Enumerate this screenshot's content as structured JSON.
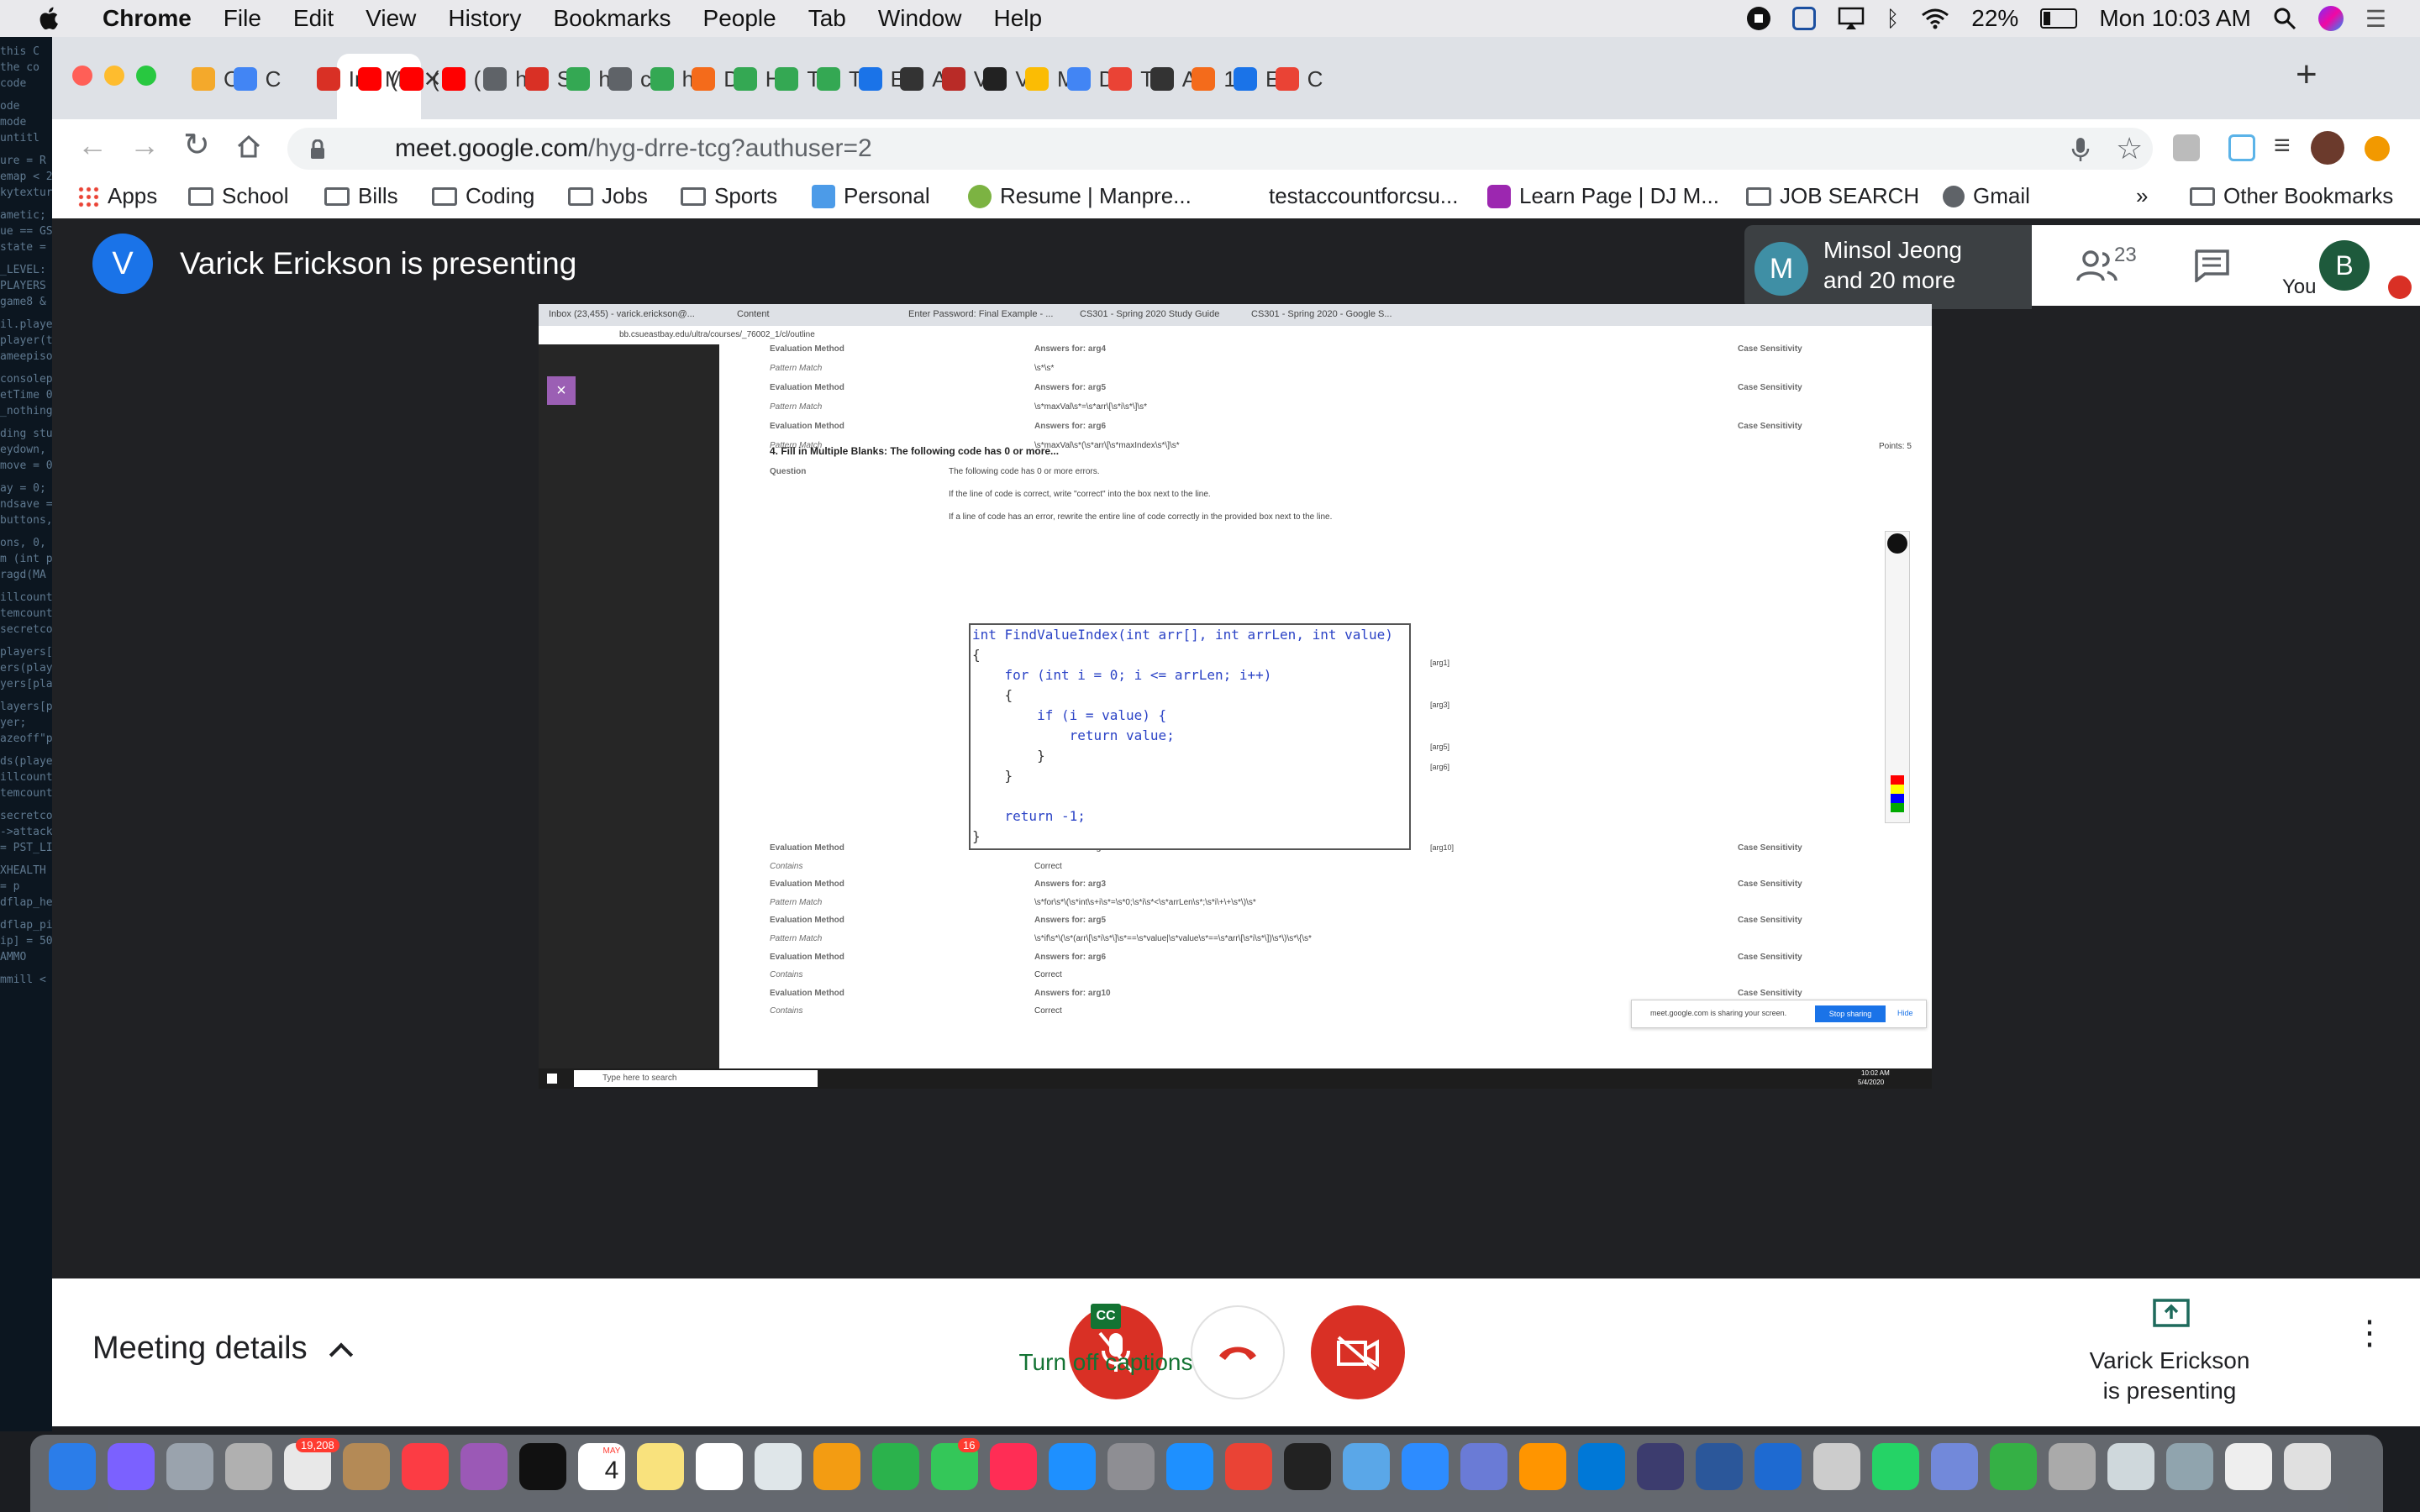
{
  "menubar": {
    "app_name": "Chrome",
    "items": [
      "File",
      "Edit",
      "View",
      "History",
      "Bookmarks",
      "People",
      "Tab",
      "Window",
      "Help"
    ],
    "battery": "22%",
    "clock": "Mon 10:03 AM"
  },
  "desktop_terminal_lines": [
    "this C",
    "the co",
    "code",
    "ode",
    "mode",
    "untitl",
    "ure = R",
    "emap < 2",
    "kytexture",
    "ametic;",
    "ue == GS",
    "state = -",
    "_LEVEL:",
    "PLAYERS",
    "game8 &",
    "il.player",
    "player(tl",
    "ameepiso",
    "consolepl",
    "etTime 0;",
    "_nothing",
    "ding stuff",
    "eydown, 0",
    "move = 0;",
    "ay = 0;",
    "ndsave =",
    "buttons, (",
    "ons, 0, s",
    "m (int pl",
    "ragd(MA",
    "illcount;",
    "temcount",
    "secretcou",
    "players[pl",
    "ers(playe",
    "yers[playe",
    "layers[pl",
    "yer;",
    "azeoff\"pl",
    "ds(player)",
    "illcount =",
    "temcount",
    "secretcou",
    "->attacke",
    "= PST_LI",
    "XHEALTH",
    "= p",
    "dflap_hea",
    "dflap_pis",
    "ip] = 50;",
    "AMMO",
    "mmill <"
  ],
  "browser": {
    "tabs": [
      {
        "label": "C",
        "color": "#f4a92b"
      },
      {
        "label": "C",
        "color": "#4285f4"
      },
      {
        "label": "M",
        "color": "#ffffff"
      },
      {
        "label": "Ir",
        "color": "#d93025"
      },
      {
        "label": "(",
        "color": "#ff0000"
      },
      {
        "label": "(",
        "color": "#ff0000"
      },
      {
        "label": "(",
        "color": "#ff0000"
      },
      {
        "label": "h",
        "color": "#5f6368"
      },
      {
        "label": "S",
        "color": "#d93025"
      },
      {
        "label": "h",
        "color": "#34a853"
      },
      {
        "label": "c",
        "color": "#5f6368"
      },
      {
        "label": "h",
        "color": "#34a853"
      },
      {
        "label": "D",
        "color": "#f46b1b"
      },
      {
        "label": "H",
        "color": "#34a853"
      },
      {
        "label": "T",
        "color": "#34a853"
      },
      {
        "label": "T",
        "color": "#34a853"
      },
      {
        "label": "E",
        "color": "#1a73e8"
      },
      {
        "label": "A",
        "color": "#333333"
      },
      {
        "label": "V",
        "color": "#b92b27"
      },
      {
        "label": "V",
        "color": "#222222"
      },
      {
        "label": "M",
        "color": "#fbbc04"
      },
      {
        "label": "D",
        "color": "#4285f4"
      },
      {
        "label": "T",
        "color": "#ea4335"
      },
      {
        "label": "A",
        "color": "#333333"
      },
      {
        "label": "1",
        "color": "#f46b1b"
      },
      {
        "label": "E",
        "color": "#1a73e8"
      },
      {
        "label": "C",
        "color": "#ea4335"
      }
    ],
    "url_host": "meet.google.com",
    "url_path": "/hyg-drre-tcg?authuser=2",
    "bookmarks": [
      "Apps",
      "School",
      "Bills",
      "Coding",
      "Jobs",
      "Sports",
      "Personal",
      "Resume | Manpre...",
      "testaccountforcsu...",
      "Learn Page | DJ M...",
      "JOB SEARCH",
      "Gmail"
    ],
    "overflow": "»",
    "other_bookmarks": "Other Bookmarks"
  },
  "meet": {
    "presenter_initial": "V",
    "presenting_text": "Varick Erickson is presenting",
    "participant_initial": "M",
    "participant_name": "Minsol Jeong",
    "participant_more": "and 20 more",
    "people_count": "23",
    "you_label": "You",
    "you_initial": "B",
    "meeting_details": "Meeting details",
    "captions_label": "Turn off captions",
    "captions_icon": "CC",
    "presenting_line1": "Varick Erickson",
    "presenting_line2": "is presenting"
  },
  "shared": {
    "tabs": [
      "Inbox (23,455) - varick.erickson@...",
      "Content",
      "Enter Password: Final Example - ...",
      "CS301 - Spring 2020 Study Guide",
      "CS301 - Spring 2020 - Google S..."
    ],
    "url": "bb.csueastbay.edu/ultra/courses/_76002_1/cl/outline",
    "upper_rows": [
      {
        "left": "Evaluation Method",
        "mid": "Answers for: arg4",
        "right": "Case Sensitivity"
      },
      {
        "left": "Pattern Match",
        "mid": "\\s*\\s*",
        "right": ""
      },
      {
        "left": "Evaluation Method",
        "mid": "Answers for: arg5",
        "right": "Case Sensitivity"
      },
      {
        "left": "Pattern Match",
        "mid": "\\s*maxVal\\s*=\\s*arr\\[\\s*i\\s*\\]\\s*",
        "right": ""
      },
      {
        "left": "Evaluation Method",
        "mid": "Answers for: arg6",
        "right": "Case Sensitivity"
      },
      {
        "left": "Pattern Match",
        "mid": "\\s*maxVal\\s*(\\s*arr\\[\\s*maxIndex\\s*\\]\\s*",
        "right": ""
      }
    ],
    "question_title": "4.  Fill in Multiple Blanks: The following code has 0 or more...",
    "points": "Points: 5",
    "question_label": "Question",
    "question_lines": [
      "The following code has 0 or more errors.",
      "If the line of code is correct, write \"correct\" into the box next to the line.",
      "If a line of code has an error, rewrite the entire line of code correctly in the provided box next to the line."
    ],
    "code_lines": [
      "int FindValueIndex(int arr[], int arrLen, int value)",
      "{",
      "    for (int i = 0; i <= arrLen; i++)",
      "    {",
      "        if (i = value) {",
      "            return value;",
      "        }",
      "    }",
      "",
      "    return -1;",
      "}"
    ],
    "arg_labels": [
      "[arg1]",
      "[arg3]",
      "[arg5]",
      "[arg6]",
      "[arg10]"
    ],
    "lower_rows": [
      {
        "left": "Evaluation Method",
        "mid": "Answers for: arg1",
        "right": "Case Sensitivity"
      },
      {
        "left": "Contains",
        "mid": "Correct",
        "right": ""
      },
      {
        "left": "Evaluation Method",
        "mid": "Answers for: arg3",
        "right": "Case Sensitivity"
      },
      {
        "left": "Pattern Match",
        "mid": "\\s*for\\s*\\(\\s*int\\s+i\\s*=\\s*0;\\s*i\\s*<\\s*arrLen\\s*;\\s*i\\+\\+\\s*\\)\\s*",
        "right": ""
      },
      {
        "left": "Evaluation Method",
        "mid": "Answers for: arg5",
        "right": "Case Sensitivity"
      },
      {
        "left": "Pattern Match",
        "mid": "\\s*if\\s*\\(\\s*(arr\\[\\s*i\\s*\\]\\s*==\\s*value|\\s*value\\s*==\\s*arr\\[\\s*i\\s*\\])\\s*\\)\\s*\\{\\s*",
        "right": ""
      },
      {
        "left": "Evaluation Method",
        "mid": "Answers for: arg6",
        "right": "Case Sensitivity"
      },
      {
        "left": "Contains",
        "mid": "Correct",
        "right": ""
      },
      {
        "left": "Evaluation Method",
        "mid": "Answers for: arg10",
        "right": "Case Sensitivity"
      },
      {
        "left": "Contains",
        "mid": "Correct",
        "right": ""
      }
    ],
    "sharing_notice": "meet.google.com is sharing your screen.",
    "stop_sharing": "Stop sharing",
    "hide": "Hide",
    "search_placeholder": "Type here to search",
    "time": "10:02 AM",
    "date": "5/4/2020"
  },
  "dock": {
    "badges": {
      "photos": "19,208",
      "messages": "16"
    },
    "calendar_month": "MAY",
    "calendar_day": "4"
  }
}
